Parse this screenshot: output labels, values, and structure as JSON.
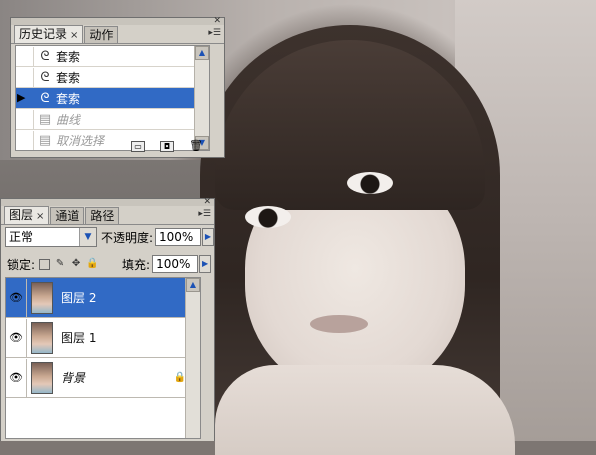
{
  "history": {
    "tabs": [
      {
        "label": "历史记录",
        "close": "×"
      },
      {
        "label": "动作"
      }
    ],
    "items": [
      {
        "label": "套索",
        "icon": "lasso-icon",
        "state": "normal"
      },
      {
        "label": "套索",
        "icon": "lasso-icon",
        "state": "normal"
      },
      {
        "label": "套索",
        "icon": "lasso-icon",
        "state": "selected"
      },
      {
        "label": "曲线",
        "icon": "history-doc-icon",
        "state": "dimmed"
      },
      {
        "label": "取消选择",
        "icon": "history-doc-icon",
        "state": "dimmed"
      }
    ]
  },
  "layers_panel": {
    "tabs": [
      {
        "label": "图层",
        "close": "×"
      },
      {
        "label": "通道"
      },
      {
        "label": "路径"
      }
    ],
    "blend_mode": "正常",
    "opacity_label": "不透明度:",
    "opacity_value": "100%",
    "lock_label": "锁定:",
    "fill_label": "填充:",
    "fill_value": "100%",
    "layers": [
      {
        "name": "图层 2",
        "selected": true,
        "locked": false
      },
      {
        "name": "图层 1",
        "selected": false,
        "locked": false
      },
      {
        "name": "背景",
        "selected": false,
        "locked": true
      }
    ]
  },
  "colors": {
    "selection": "#316ac5",
    "panel_bg": "#d4d0c8"
  }
}
